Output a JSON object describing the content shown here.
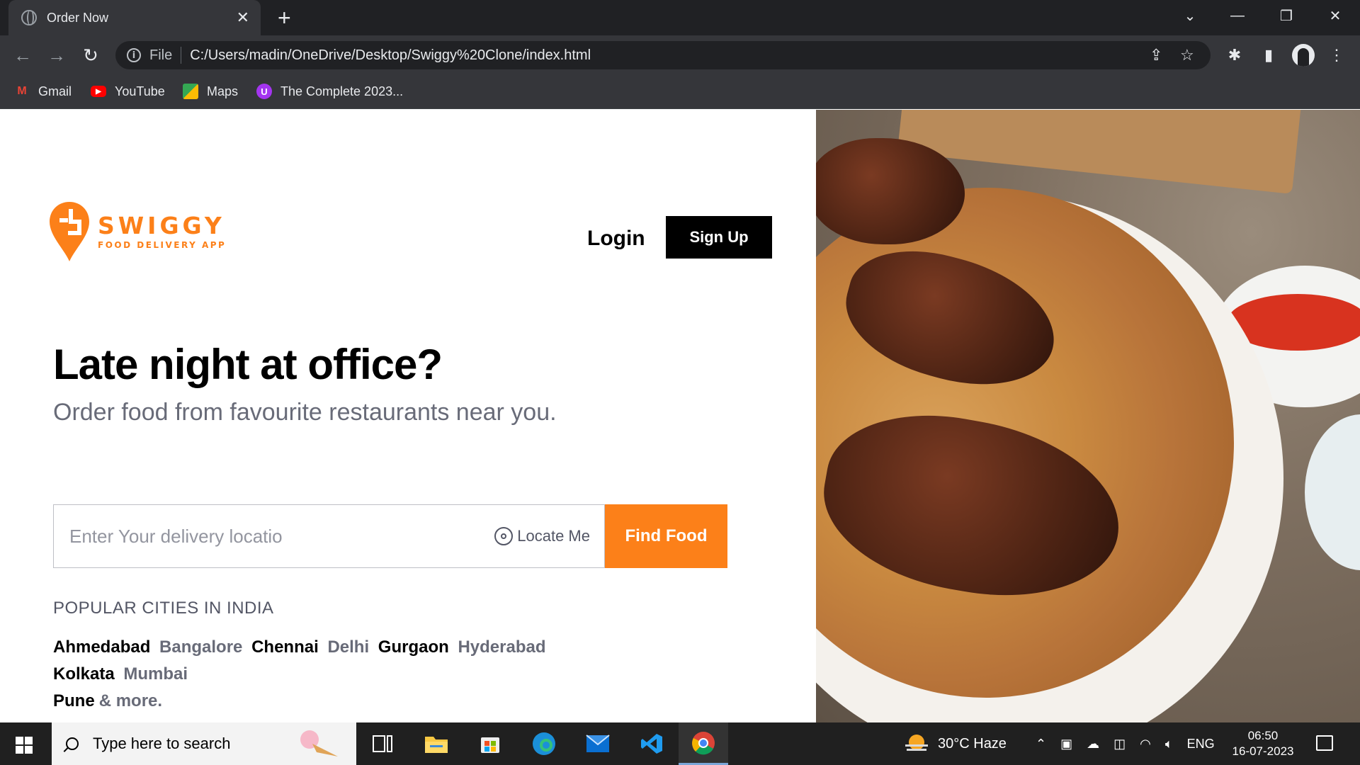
{
  "browser": {
    "tab_title": "Order Now",
    "address_scheme": "File",
    "address_url": "C:/Users/madin/OneDrive/Desktop/Swiggy%20Clone/index.html",
    "bookmarks": [
      {
        "label": "Gmail",
        "icon": "gmail-icon"
      },
      {
        "label": "YouTube",
        "icon": "youtube-icon"
      },
      {
        "label": "Maps",
        "icon": "maps-icon"
      },
      {
        "label": "The Complete 2023...",
        "icon": "udemy-icon"
      }
    ]
  },
  "site": {
    "logo": {
      "name": "SWIGGY",
      "tagline": "FOOD DELIVERY APP",
      "color": "#fc8019"
    },
    "nav": {
      "login": "Login",
      "signup": "Sign Up"
    },
    "hero": {
      "headline": "Late night at office?",
      "subline": "Order food from favourite restaurants near you."
    },
    "search": {
      "placeholder": "Enter Your delivery locatio",
      "locate_label": "Locate Me",
      "button_label": "Find Food"
    },
    "cities": {
      "title": "POPULAR CITIES IN INDIA",
      "list": [
        "Ahmedabad",
        "Bangalore",
        "Chennai",
        "Delhi",
        "Gurgaon",
        "Hyderabad",
        "Kolkata",
        "Mumbai",
        "Pune"
      ],
      "more": "& more."
    },
    "colors": {
      "accent": "#fc8019",
      "dark": "#000000",
      "grey": "#686b78"
    }
  },
  "taskbar": {
    "search_placeholder": "Type here to search",
    "weather": "30°C  Haze",
    "language": "ENG",
    "time": "06:50",
    "date": "16-07-2023"
  }
}
